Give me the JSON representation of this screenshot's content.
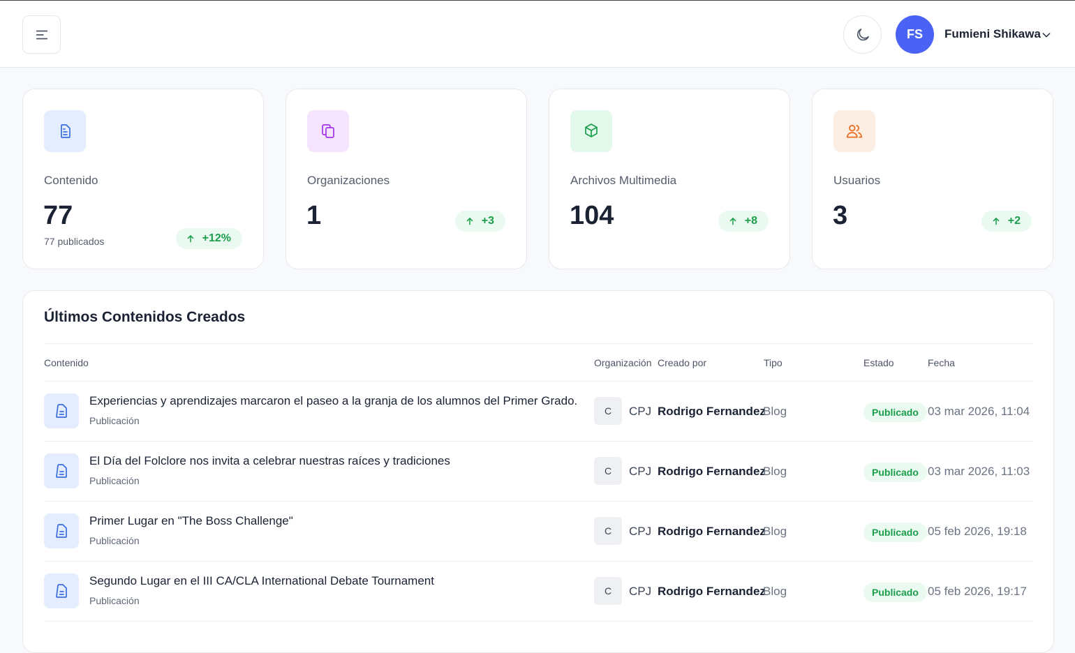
{
  "header": {
    "menu_icon": "menu-icon",
    "theme_icon": "moon-icon",
    "user": {
      "initials": "FS",
      "name": "Fumieni Shikawa",
      "chevron_icon": "chevron-down-icon"
    },
    "colors": {
      "avatar": "#4b63f5"
    }
  },
  "stats": [
    {
      "label": "Contenido",
      "value": "77",
      "sub": "77 publicados",
      "change": "+12%",
      "icon": "document-icon",
      "icon_bg": "#e3edfd",
      "icon_color": "#3b6de0"
    },
    {
      "label": "Organizaciones",
      "value": "1",
      "sub": "",
      "change": "+3",
      "icon": "copy-icon",
      "icon_bg": "#f4e5fd",
      "icon_color": "#a132e8"
    },
    {
      "label": "Archivos Multimedia",
      "value": "104",
      "sub": "",
      "change": "+8",
      "icon": "cube-icon",
      "icon_bg": "#e2f8ea",
      "icon_color": "#1b9e4b"
    },
    {
      "label": "Usuarios",
      "value": "3",
      "sub": "",
      "change": "+2",
      "icon": "users-icon",
      "icon_bg": "#fdeee3",
      "icon_color": "#ea6a1e"
    }
  ],
  "table": {
    "title": "Últimos Contenidos Creados",
    "columns": [
      "Contenido",
      "Organización",
      "Creado por",
      "Tipo",
      "Estado",
      "Fecha"
    ],
    "rows": [
      {
        "title": "Experiencias y aprendizajes marcaron el paseo a la granja de los alumnos del Primer Grado.",
        "type": "Publicación",
        "org_initial": "C",
        "org": "CPJ",
        "creator": "Rodrigo Fernandez",
        "tipo": "Blog",
        "status": "Publicado",
        "date": "03 mar 2026, 11:04"
      },
      {
        "title": "El Día del Folclore nos invita a celebrar nuestras raíces y tradiciones",
        "type": "Publicación",
        "org_initial": "C",
        "org": "CPJ",
        "creator": "Rodrigo Fernandez",
        "tipo": "Blog",
        "status": "Publicado",
        "date": "03 mar 2026, 11:03"
      },
      {
        "title": "Primer Lugar en \"The Boss Challenge\"",
        "type": "Publicación",
        "org_initial": "C",
        "org": "CPJ",
        "creator": "Rodrigo Fernandez",
        "tipo": "Blog",
        "status": "Publicado",
        "date": "05 feb 2026, 19:18"
      },
      {
        "title": "Segundo Lugar en el III CA/CLA International Debate Tournament",
        "type": "Publicación",
        "org_initial": "C",
        "org": "CPJ",
        "creator": "Rodrigo Fernandez",
        "tipo": "Blog",
        "status": "Publicado",
        "date": "05 feb 2026, 19:17"
      }
    ]
  }
}
